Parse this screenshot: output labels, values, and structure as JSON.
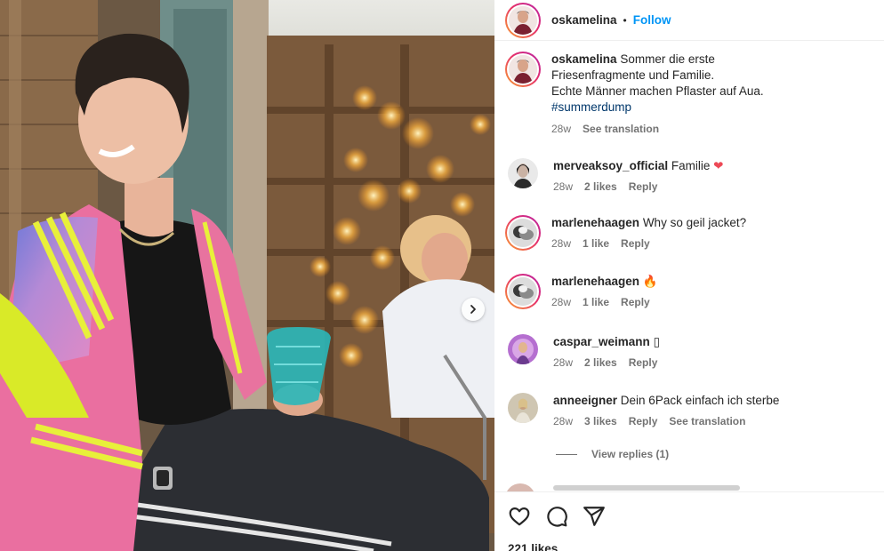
{
  "post": {
    "author": "oskamelina",
    "dot": "•",
    "follow_label": "Follow",
    "caption_line1": "Sommer die erste",
    "caption_line2": "Friesenfragmente und Familie.",
    "caption_line3": "Echte Männer machen Pflaster auf Aua.",
    "hashtag": "#summerdump",
    "time": "28w",
    "see_translation": "See translation",
    "likes": "221 likes"
  },
  "comments": [
    {
      "user": "merveaksoy_official",
      "text": "Familie ",
      "emoji": "❤",
      "time": "28w",
      "likes": "2 likes",
      "reply": "Reply"
    },
    {
      "user": "marlenehaagen",
      "text": "Why so geil jacket?",
      "time": "28w",
      "likes": "1 like",
      "reply": "Reply"
    },
    {
      "user": "marlenehaagen",
      "text": "",
      "emoji": "🔥",
      "time": "28w",
      "likes": "1 like",
      "reply": "Reply"
    },
    {
      "user": "caspar_weimann",
      "text": "▯",
      "time": "28w",
      "likes": "2 likes",
      "reply": "Reply"
    },
    {
      "user": "anneeigner",
      "text": "Dein 6Pack einfach ich sterbe",
      "time": "28w",
      "likes": "3 likes",
      "reply": "Reply",
      "see_translation": "See translation"
    }
  ],
  "view_replies": "View replies (1)",
  "icons": {
    "like": "heart-icon",
    "comment": "comment-icon",
    "share": "send-icon",
    "carousel_next": "chevron-right-icon"
  },
  "colors": {
    "follow": "#0095f6",
    "hashtag": "#00376b",
    "muted": "#737373",
    "heart": "#ed4956"
  }
}
